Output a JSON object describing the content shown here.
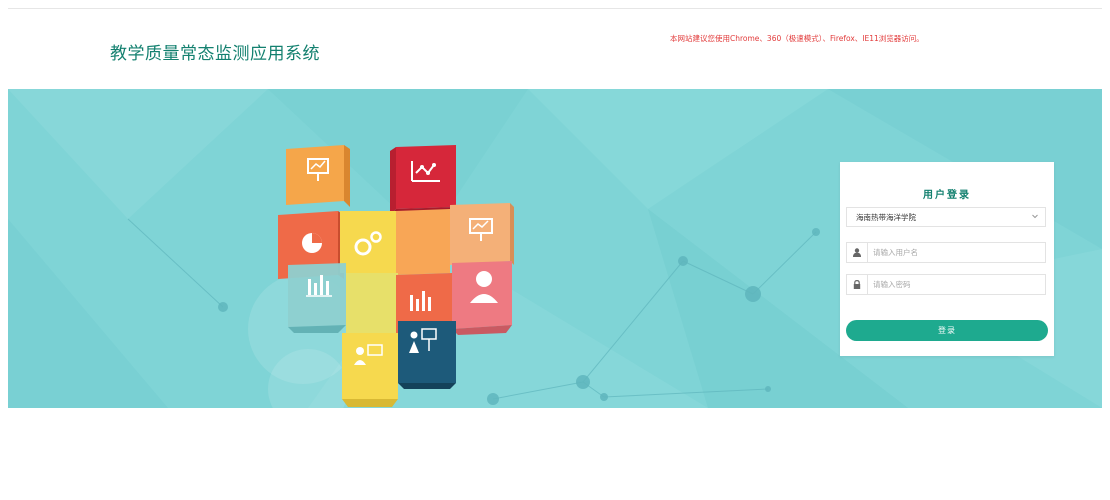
{
  "header": {
    "site_title": "教学质量常态监测应用系统",
    "browser_notice": "本网站建议您使用Chrome、360（极速模式）、Firefox、IE11浏览器访问。"
  },
  "banner": {
    "background_color": "#7fd4d6",
    "tiles": [
      {
        "icon": "presentation-chart-icon",
        "color": "#f5a64a"
      },
      {
        "icon": "line-chart-icon",
        "color": "#d6273a"
      },
      {
        "icon": "pie-chart-icon",
        "color": "#ef6a48"
      },
      {
        "icon": "gears-icon",
        "color": "#f6d94e"
      },
      {
        "icon": "presentation-chart-icon",
        "color": "#f4b078"
      },
      {
        "icon": "bar-chart-icon",
        "color": "#8ed0d0"
      },
      {
        "icon": "bar-chart-icon",
        "color": "#ef6a48"
      },
      {
        "icon": "user-icon",
        "color": "#ee7a82"
      },
      {
        "icon": "presenter-icon",
        "color": "#f6d94e"
      },
      {
        "icon": "presenter-icon",
        "color": "#1d5a7a"
      }
    ]
  },
  "login": {
    "title": "用户登录",
    "school_select_value": "海南热带海洋学院",
    "username_placeholder": "请输入用户名",
    "password_placeholder": "请输入密码",
    "submit_label": "登录",
    "accent_color": "#1eaa8f"
  }
}
